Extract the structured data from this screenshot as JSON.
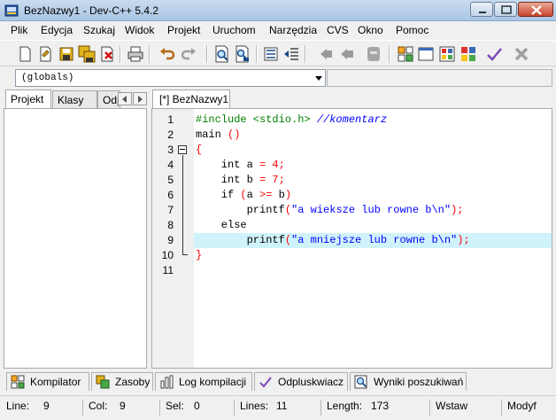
{
  "window": {
    "title": "BezNazwy1 - Dev-C++ 5.4.2"
  },
  "menu": [
    "Plik",
    "Edycja",
    "Szukaj",
    "Widok",
    "Projekt",
    "Uruchom",
    "Narzędzia",
    "CVS",
    "Okno",
    "Pomoc"
  ],
  "toolbar_icons": [
    "new-file-icon",
    "open-file-icon",
    "save-icon",
    "save-all-icon",
    "close-file-icon",
    "print-icon",
    "undo-icon",
    "redo-icon",
    "find-icon",
    "replace-icon",
    "indent-icon",
    "unindent-icon",
    "goto-back-icon",
    "goto-forward-icon",
    "bookmark-icon",
    "compile-icon",
    "run-icon",
    "compile-run-icon",
    "rebuild-icon",
    "check-syntax-icon",
    "stop-icon"
  ],
  "globals": {
    "value": "(globals)"
  },
  "left_tabs": [
    "Projekt",
    "Klasy",
    "Odp"
  ],
  "editor": {
    "tab_label": "[*] BezNazwy1",
    "line_numbers": [
      "1",
      "2",
      "3",
      "4",
      "5",
      "6",
      "7",
      "8",
      "9",
      "10",
      "11"
    ],
    "lines": [
      [
        {
          "t": "#include <stdio.h> ",
          "c": "pre"
        },
        {
          "t": "//komentarz",
          "c": "cmt"
        }
      ],
      [
        {
          "t": "main ",
          "c": "kw"
        },
        {
          "t": "()",
          "c": "sym"
        }
      ],
      [
        {
          "t": "{",
          "c": "sym"
        }
      ],
      [
        {
          "t": "    int a ",
          "c": "kw"
        },
        {
          "t": "=",
          "c": "sym"
        },
        {
          "t": " ",
          "c": "kw"
        },
        {
          "t": "4",
          "c": "num"
        },
        {
          "t": ";",
          "c": "sym"
        }
      ],
      [
        {
          "t": "    int b ",
          "c": "kw"
        },
        {
          "t": "=",
          "c": "sym"
        },
        {
          "t": " ",
          "c": "kw"
        },
        {
          "t": "7",
          "c": "num"
        },
        {
          "t": ";",
          "c": "sym"
        }
      ],
      [
        {
          "t": "    if ",
          "c": "kw"
        },
        {
          "t": "(",
          "c": "sym"
        },
        {
          "t": "a ",
          "c": "kw"
        },
        {
          "t": ">=",
          "c": "sym"
        },
        {
          "t": " b",
          "c": "kw"
        },
        {
          "t": ")",
          "c": "sym"
        }
      ],
      [
        {
          "t": "        printf",
          "c": "kw"
        },
        {
          "t": "(",
          "c": "sym"
        },
        {
          "t": "\"a wieksze lub rowne b\\n\"",
          "c": "str"
        },
        {
          "t": ");",
          "c": "sym"
        }
      ],
      [
        {
          "t": "    else",
          "c": "kw"
        }
      ],
      [
        {
          "t": "        printf",
          "c": "kw"
        },
        {
          "t": "(",
          "c": "sym"
        },
        {
          "t": "\"a mniejsze lub rowne b\\n\"",
          "c": "str"
        },
        {
          "t": ");",
          "c": "sym"
        }
      ],
      [
        {
          "t": "}",
          "c": "sym"
        }
      ],
      []
    ],
    "highlighted_line": 9,
    "highlight_color": "#cff3fb"
  },
  "bottom_tabs": [
    {
      "label": "Kompilator",
      "icon": "compiler-grid-icon"
    },
    {
      "label": "Zasoby",
      "icon": "resources-icon"
    },
    {
      "label": "Log kompilacji",
      "icon": "compile-log-icon"
    },
    {
      "label": "Odpluskwiacz",
      "icon": "debugger-check-icon"
    },
    {
      "label": "Wyniki poszukiwań",
      "icon": "search-results-icon"
    }
  ],
  "status": {
    "line_label": "Line:",
    "line_value": "9",
    "col_label": "Col:",
    "col_value": "9",
    "sel_label": "Sel:",
    "sel_value": "0",
    "lines_label": "Lines:",
    "lines_value": "11",
    "length_label": "Length:",
    "length_value": "173",
    "insert_mode": "Wstaw",
    "modified": "Modyf"
  }
}
